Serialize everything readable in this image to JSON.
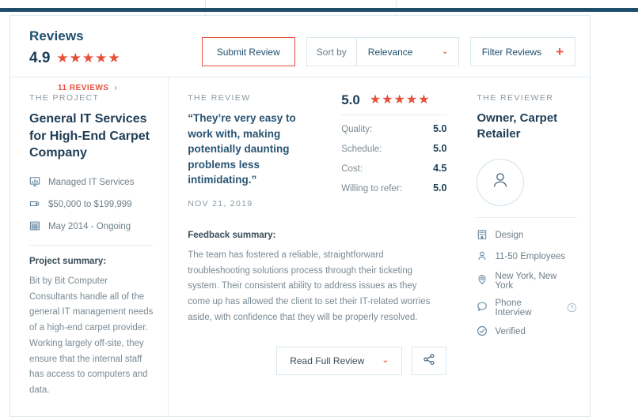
{
  "theme": {
    "accent_red": "#e8503a",
    "navy": "#1f4e6d",
    "topbar": "#1f4e6d",
    "border": "#dce9f0",
    "muted_text": "#7b8a93"
  },
  "header": {
    "title": "Reviews",
    "score": "4.9",
    "stars": "★★★★★",
    "reviews_link": "11 REVIEWS",
    "reviews_link_chevron": "›",
    "submit_label": "Submit Review",
    "sort_label": "Sort by",
    "sort_value": "Relevance",
    "sort_chevron": "⌄",
    "filter_label": "Filter Reviews",
    "filter_plus": "+"
  },
  "project": {
    "eyebrow": "THE PROJECT",
    "title": "General IT Services for High-End Carpet Company",
    "meta": [
      {
        "icon": "presentation-icon",
        "label": "Managed IT Services"
      },
      {
        "icon": "price-tag-icon",
        "label": "$50,000 to $199,999"
      },
      {
        "icon": "calendar-icon",
        "label": "May 2014 - Ongoing"
      }
    ],
    "summary_head": "Project summary:",
    "summary_body": "Bit by Bit Computer Consultants handle all of the general IT management needs of a high-end carpet provider. Working largely off-site, they ensure that the internal staff has access to computers and data."
  },
  "review": {
    "eyebrow": "THE REVIEW",
    "quote": "“They’re very easy to work with, making potentially daunting problems less intimidating.”",
    "date": "NOV 21, 2019",
    "overall_score": "5.0",
    "overall_stars": "★★★★★",
    "ratings": [
      {
        "label": "Quality:",
        "value": "5.0"
      },
      {
        "label": "Schedule:",
        "value": "5.0"
      },
      {
        "label": "Cost:",
        "value": "4.5"
      },
      {
        "label": "Willing to refer:",
        "value": "5.0"
      }
    ],
    "feedback_head": "Feedback summary:",
    "feedback_body": "The team has fostered a reliable, straightforward troubleshooting solutions process through their ticketing system. Their consistent ability to address issues as they come up has allowed the client to set their IT-related worries aside, with confidence that they will be properly resolved.",
    "read_full_label": "Read Full Review",
    "read_full_chevron": "⌄",
    "share_icon": "share-icon"
  },
  "reviewer": {
    "eyebrow": "THE REVIEWER",
    "title": "Owner, Carpet Retailer",
    "avatar_icon": "person-avatar-icon",
    "details": [
      {
        "icon": "building-icon",
        "label": "Design"
      },
      {
        "icon": "person-icon",
        "label": "11-50 Employees"
      },
      {
        "icon": "location-pin-icon",
        "label": "New York, New York"
      },
      {
        "icon": "speech-bubble-icon",
        "label": "Phone Interview",
        "badge": "question-mark-circle-icon"
      },
      {
        "icon": "check-circle-icon",
        "label": "Verified"
      }
    ]
  }
}
